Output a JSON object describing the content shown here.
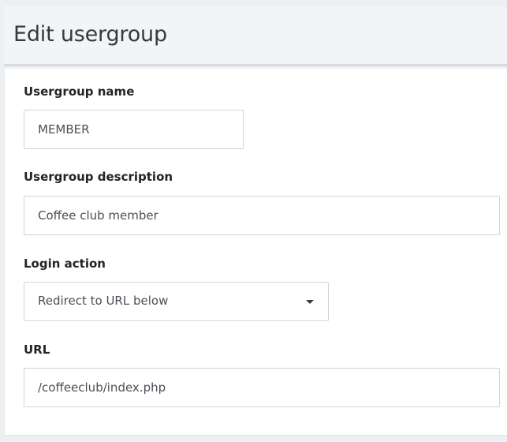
{
  "header": {
    "title": "Edit usergroup"
  },
  "form": {
    "name": {
      "label": "Usergroup name",
      "value": "MEMBER"
    },
    "description": {
      "label": "Usergroup description",
      "value": "Coffee club member"
    },
    "login_action": {
      "label": "Login action",
      "selected": "Redirect to URL below",
      "icon": "caret-down-icon"
    },
    "url": {
      "label": "URL",
      "value": "/coffeeclub/index.php"
    }
  }
}
